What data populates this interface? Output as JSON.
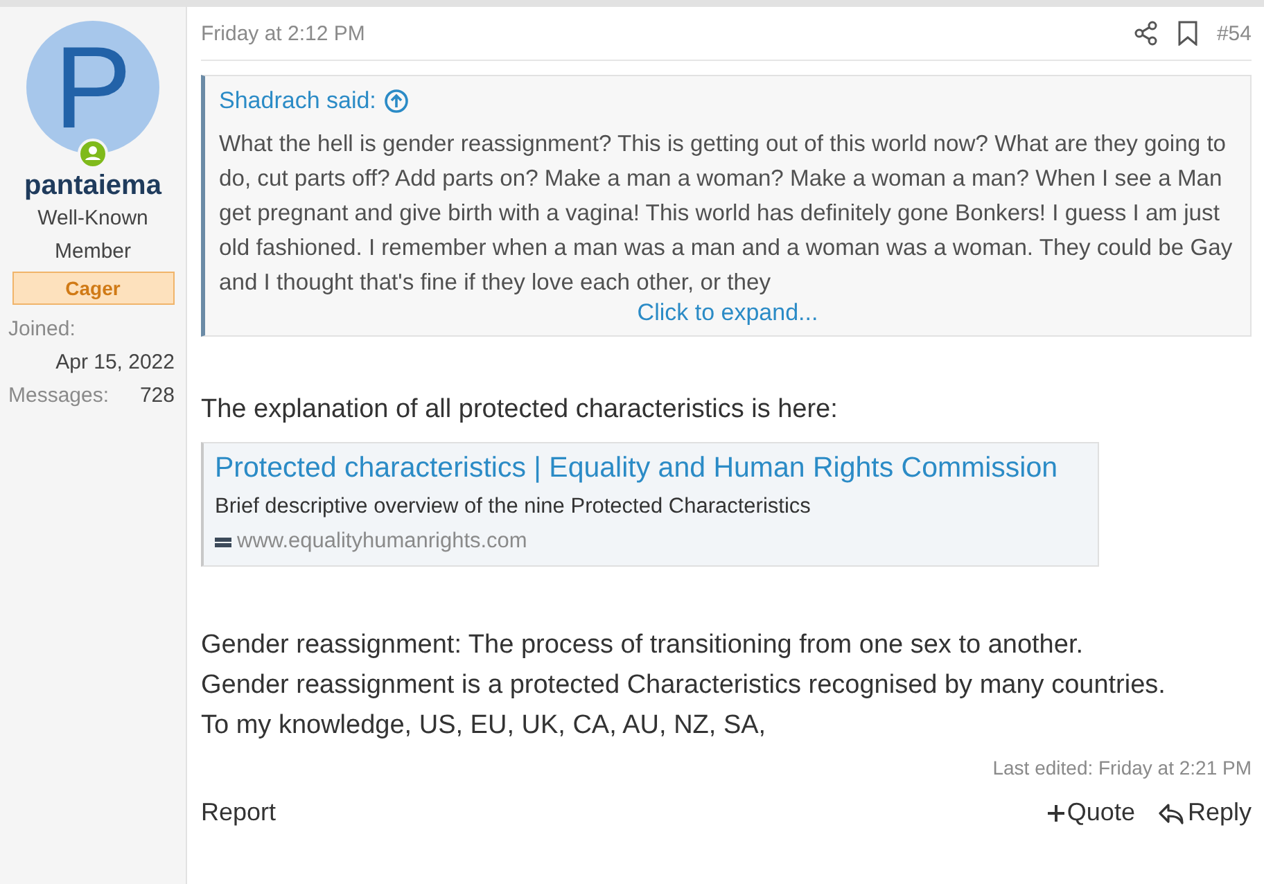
{
  "author": {
    "initial": "P",
    "online": true,
    "name": "pantaiema",
    "title": "Well-Known Member",
    "banner": "Cager",
    "stats": [
      {
        "label": "Joined:",
        "value": "Apr 15, 2022"
      },
      {
        "label": "Messages:",
        "value": "728"
      }
    ]
  },
  "post": {
    "date": "Friday at 2:12 PM",
    "number": "#54",
    "quote": {
      "attribution": "Shadrach said:",
      "text": "What the hell is gender reassignment? This is getting out of this world now? What are they going to do, cut parts off? Add parts on? Make a man a woman? Make a woman a man? When I see a Man get pregnant and give birth with a vagina! This world has definitely gone Bonkers! I guess I am just old fashioned. I remember when a man was a man and a woman was a woman. They could be Gay and I thought that's fine if they love each other, or they",
      "expand": "Click to expand..."
    },
    "intro": "The explanation of all protected characteristics is here:",
    "link_card": {
      "title": "Protected characteristics | Equality and Human Rights Commission",
      "description": "Brief descriptive overview of the nine Protected Characteristics",
      "domain": "www.equalityhumanrights.com"
    },
    "paragraphs": [
      "Gender reassignment: The process of transitioning from one sex to another.",
      "Gender reassignment is a protected Characteristics recognised by many countries.",
      "To my knowledge, US, EU, UK, CA, AU, NZ, SA,"
    ],
    "last_edited": "Last edited: Friday at 2:21 PM",
    "actions": [
      {
        "kind": "report",
        "label": "Report"
      },
      {
        "kind": "quote",
        "label": "Quote"
      },
      {
        "kind": "reply",
        "label": "Reply"
      }
    ]
  }
}
